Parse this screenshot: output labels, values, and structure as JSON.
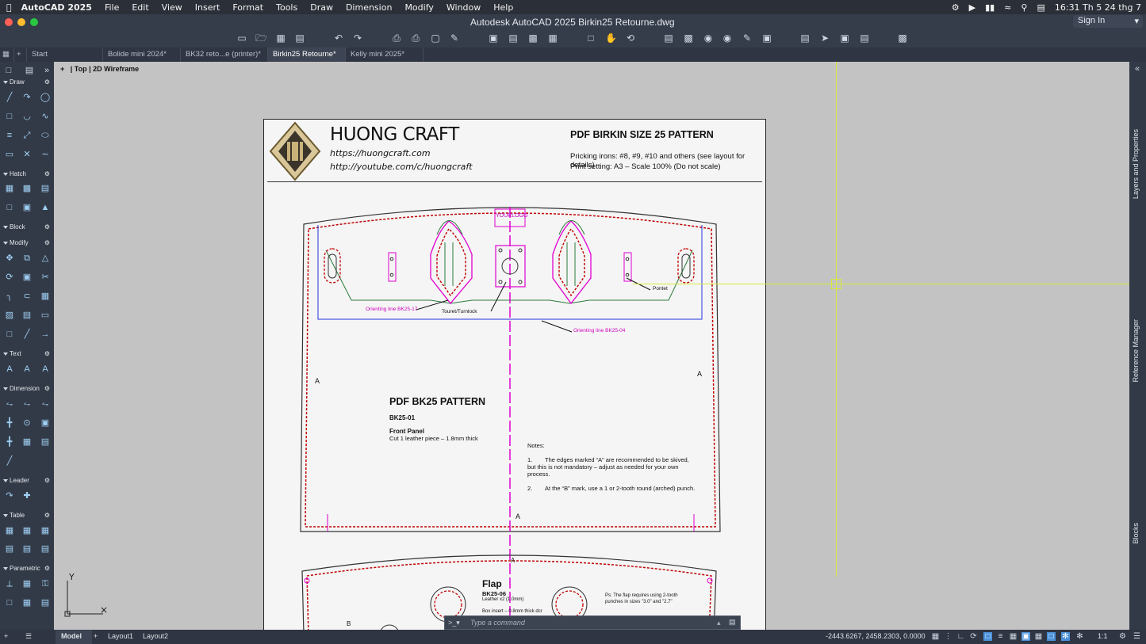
{
  "menubar": {
    "app": "AutoCAD 2025",
    "items": [
      "File",
      "Edit",
      "View",
      "Insert",
      "Format",
      "Tools",
      "Draw",
      "Dimension",
      "Modify",
      "Window",
      "Help"
    ],
    "clock": "16:31 Th 5 24 thg 7"
  },
  "titlebar": {
    "title": "Autodesk AutoCAD 2025   Birkin25 Retourne.dwg",
    "sign_in": "Sign In"
  },
  "tabs": {
    "start": "Start",
    "docs": [
      "Bolide mini 2024*",
      "BK32 reto...e (printer)*",
      "Birkin25 Retourne*",
      "Kelly mini 2025*"
    ],
    "active_index": 2
  },
  "viewport": {
    "plus": "+",
    "view": "Top",
    "style": "2D Wireframe"
  },
  "palette": {
    "sections": [
      "Draw",
      "Hatch",
      "Block",
      "Modify",
      "Text",
      "Dimension",
      "Leader",
      "Table",
      "Parametric"
    ]
  },
  "right_palettes": [
    "Layers and Properties",
    "Reference Manager",
    "Blocks"
  ],
  "sheet": {
    "brand": "HUONG CRAFT",
    "url1": "https://huongcraft.com",
    "url2": "http://youtube.com/c/huongcraft",
    "pattern_title": "PDF BIRKIN SIZE 25 PATTERN",
    "line1": "Pricking irons: #8, #9, #10 and others (see layout for details)",
    "line2": "Print setting: A3 – Scale 100% (Do not scale)",
    "logo_box": "YOURLOGO",
    "label_orient1": "Orienting line BK25-17",
    "label_touret": "Touret/Turnlock",
    "label_pontet": "Pontet",
    "label_orient2": "Orienting line BK25-04",
    "mark_a": "A",
    "mark_b": "B",
    "piece_title": "PDF BK25 PATTERN",
    "piece_code": "BK25-01",
    "piece_name": "Front Panel",
    "piece_cut": "Cut 1 leather piece – 1.8mm thick",
    "notes_title": "Notes:",
    "note1_num": "1.",
    "note1": "The edges marked “A” are recommended to be skived, but this is not mandatory – adjust as needed for your own process.",
    "note2_num": "2.",
    "note2": "At the “B” mark, use a 1 or 2-tooth round (arched) punch.",
    "flap_title": "Flap",
    "flap_code": "BK25-06",
    "flap_leather": "Leather x2 (1.0mm)",
    "flap_box": "Box insert – 0.8mm thick dcr",
    "flap_note": "Ps: The flap requires using 2-tooth punches in sizes \"3.0\" and \"2.7\""
  },
  "command": {
    "prompt": "Type a command"
  },
  "statusbar": {
    "model": "Model",
    "layout1": "Layout1",
    "layout2": "Layout2",
    "coords": "-2443.6267, 2458.2303, 0.0000",
    "scale": "1:1"
  },
  "colors": {
    "crosshair": "#d8e83a",
    "magenta": "#e000d0",
    "stitch_red": "#c00000",
    "blue_line": "#2233dd",
    "green_line": "#2a7a3a"
  }
}
